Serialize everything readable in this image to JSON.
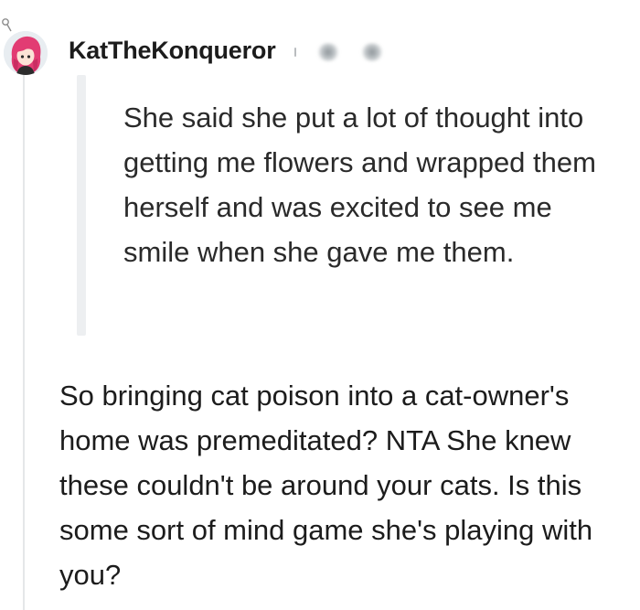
{
  "comment": {
    "author": "KatTheKonqueror",
    "quote": "She said she put a lot of thought into getting me flowers and wrapped them herself and was excited to see me smile when she gave me them.",
    "body": "So bringing cat poison into a cat-owner's home was premeditated? NTA She knew these couldn't be around your cats. Is this some sort of mind game she's playing with you?"
  },
  "icons": {
    "avatar": "user-avatar-icon",
    "meta_indicators": [
      "award-icon",
      "award-icon"
    ]
  },
  "colors": {
    "thread_line": "#e5e7e9",
    "quote_bar": "#edeff1",
    "avatar_hair": "#e23c73",
    "text": "#1c1c1c"
  }
}
